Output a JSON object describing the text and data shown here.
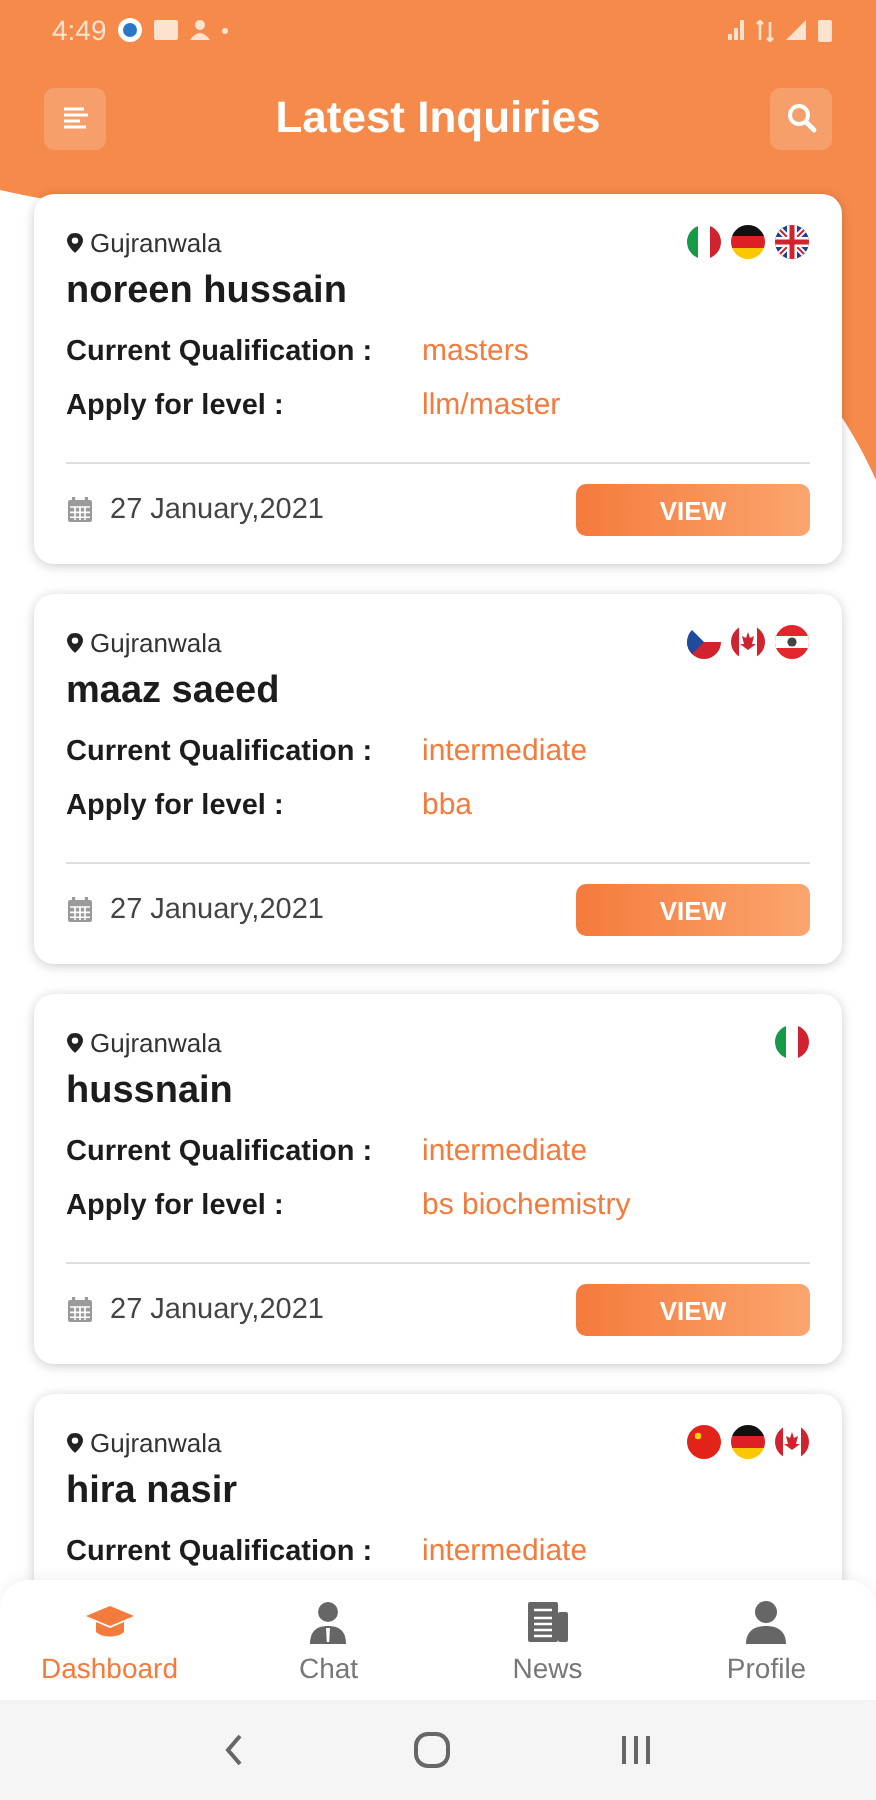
{
  "status_bar": {
    "time": "4:49"
  },
  "header": {
    "title": "Latest Inquiries"
  },
  "inquiries": [
    {
      "location": "Gujranwala",
      "name": "noreen hussain",
      "qualification_label": "Current Qualification :",
      "qualification": "masters",
      "level_label": "Apply for level :",
      "level": "llm/master",
      "date": "27 January,2021",
      "button": "VIEW",
      "flags": [
        {
          "kind": "italy"
        },
        {
          "kind": "germany"
        },
        {
          "kind": "uk"
        }
      ]
    },
    {
      "location": "Gujranwala",
      "name": "maaz saeed",
      "qualification_label": "Current Qualification :",
      "qualification": "intermediate",
      "level_label": "Apply for level :",
      "level": "bba",
      "date": "27 January,2021",
      "button": "VIEW",
      "flags": [
        {
          "kind": "czech"
        },
        {
          "kind": "canada"
        },
        {
          "kind": "austria"
        }
      ]
    },
    {
      "location": "Gujranwala",
      "name": "hussnain",
      "qualification_label": "Current Qualification :",
      "qualification": "intermediate",
      "level_label": "Apply for level :",
      "level": "bs biochemistry",
      "date": "27 January,2021",
      "button": "VIEW",
      "flags": [
        {
          "kind": "italy"
        }
      ]
    },
    {
      "location": "Gujranwala",
      "name": "hira nasir",
      "qualification_label": "Current Qualification :",
      "qualification": "intermediate",
      "flags": [
        {
          "kind": "china"
        },
        {
          "kind": "germany"
        },
        {
          "kind": "canada"
        }
      ]
    }
  ],
  "bottom_nav": [
    {
      "label": "Dashboard",
      "kind": "cap",
      "selected": true
    },
    {
      "label": "Chat",
      "kind": "person-tie",
      "selected": false
    },
    {
      "label": "News",
      "kind": "newspaper",
      "selected": false
    },
    {
      "label": "Profile",
      "kind": "person",
      "selected": false
    }
  ]
}
